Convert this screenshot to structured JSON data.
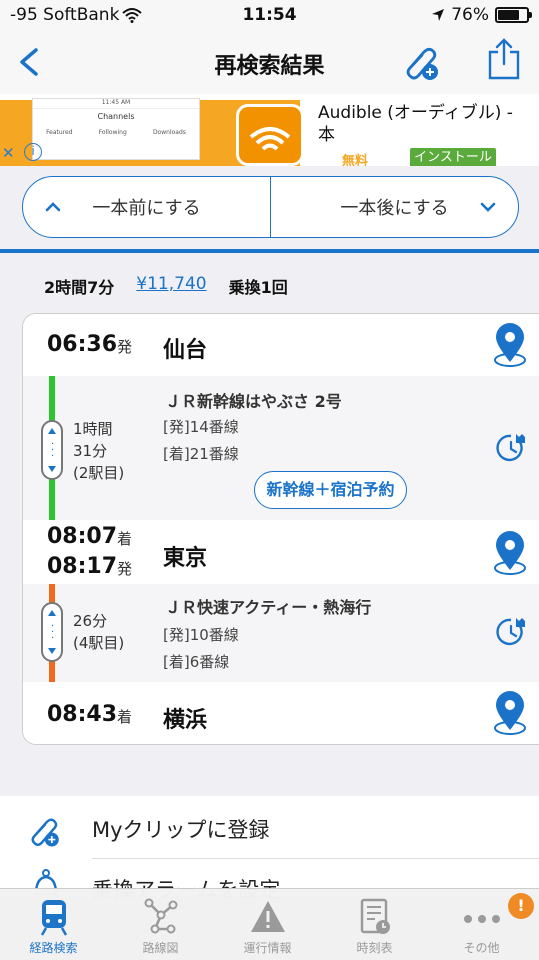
{
  "status_bar": {
    "carrier": "-95 SoftBank",
    "time": "11:54",
    "battery": "76%",
    "battery_level": 0.76
  },
  "nav": {
    "title": "再検索結果"
  },
  "ad": {
    "title_line1": "Audible (オーディブル) - 本",
    "title_line2": "...",
    "free_label": "無料",
    "install_label": "インストール",
    "thumb_time": "11:45 AM",
    "thumb_title": "Channels",
    "thumb_tabs": [
      "Featured",
      "Following",
      "Downloads"
    ],
    "close_glyph": "✕",
    "info_glyph": "i"
  },
  "segmented": {
    "prev_label": "一本前にする",
    "next_label": "一本後にする"
  },
  "summary": {
    "duration": "2時間7分",
    "fare": "¥11,740",
    "transfers": "乗換1回"
  },
  "route": {
    "stops": [
      {
        "times": [
          "06:36"
        ],
        "kinds": [
          "発"
        ],
        "station": "仙台"
      },
      {
        "times": [
          "08:07",
          "08:17"
        ],
        "kinds": [
          "着",
          "発"
        ],
        "station": "東京"
      },
      {
        "times": [
          "08:43"
        ],
        "kinds": [
          "着"
        ],
        "station": "横浜"
      }
    ],
    "segments": [
      {
        "train": "ＪＲ新幹線はやぶさ 2号",
        "departure_platform": "[発]14番線",
        "arrival_platform": "[着]21番線",
        "duration_lines": [
          "1時間",
          "31分",
          "(2駅目)"
        ],
        "line_color": "#2fc52f",
        "reserve_label": "新幹線＋宿泊予約"
      },
      {
        "train": "ＪＲ快速アクティー・熱海行",
        "departure_platform": "[発]10番線",
        "arrival_platform": "[着]6番線",
        "duration_lines": [
          "26分",
          "(4駅目)"
        ],
        "line_color": "#f06a1e"
      }
    ]
  },
  "actions": {
    "myclip_label": "Myクリップに登録",
    "alarm_label": "乗換アラームを設定"
  },
  "tabbar": {
    "tabs": [
      {
        "label": "経路検索",
        "icon": "train-icon"
      },
      {
        "label": "路線図",
        "icon": "route-map-icon"
      },
      {
        "label": "運行情報",
        "icon": "warning-icon"
      },
      {
        "label": "時刻表",
        "icon": "timetable-icon"
      },
      {
        "label": "その他",
        "icon": "more-icon"
      }
    ],
    "badge": "!"
  },
  "colors": {
    "accent": "#1a73c8",
    "shinkansen": "#2fc52f",
    "rapid": "#f06a1e",
    "badge": "#f08a24"
  }
}
